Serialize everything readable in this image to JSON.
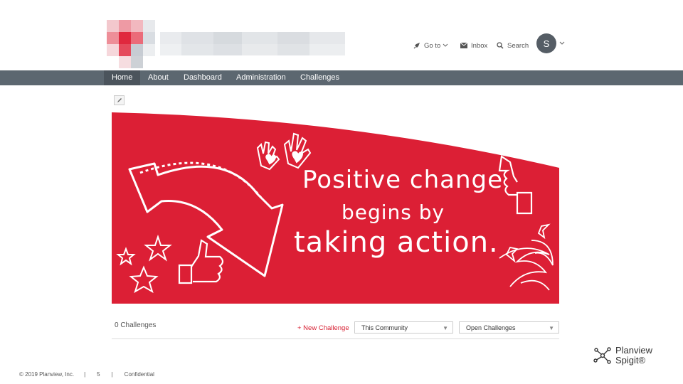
{
  "header": {
    "goto_label": "Go to",
    "inbox_label": "Inbox",
    "search_label": "Search",
    "avatar_initial": "S"
  },
  "nav": {
    "items": [
      {
        "label": "Home",
        "active": true
      },
      {
        "label": "About"
      },
      {
        "label": "Dashboard"
      },
      {
        "label": "Administration"
      },
      {
        "label": "Challenges"
      }
    ]
  },
  "banner": {
    "line1": "Positive change",
    "line2": "begins by",
    "line3": "taking action."
  },
  "challenges": {
    "count_label": "0 Challenges",
    "new_label": "+ New Challenge",
    "filter_scope": "This Community",
    "filter_status": "Open Challenges"
  },
  "footer": {
    "copyright": "© 2019 Planview, Inc.",
    "sep1": "|",
    "page": "5",
    "sep2": "|",
    "confidential": "Confidential"
  },
  "brand": {
    "line1": "Planview",
    "line2": "Spigit®"
  },
  "colors": {
    "accent": "#d71f32",
    "nav": "#5c6770",
    "avatar": "#555d65"
  },
  "icons": [
    "rocket-icon",
    "mail-icon",
    "search-icon",
    "chevron-down-icon",
    "pencil-icon",
    "planview-spigit-logo-icon"
  ]
}
